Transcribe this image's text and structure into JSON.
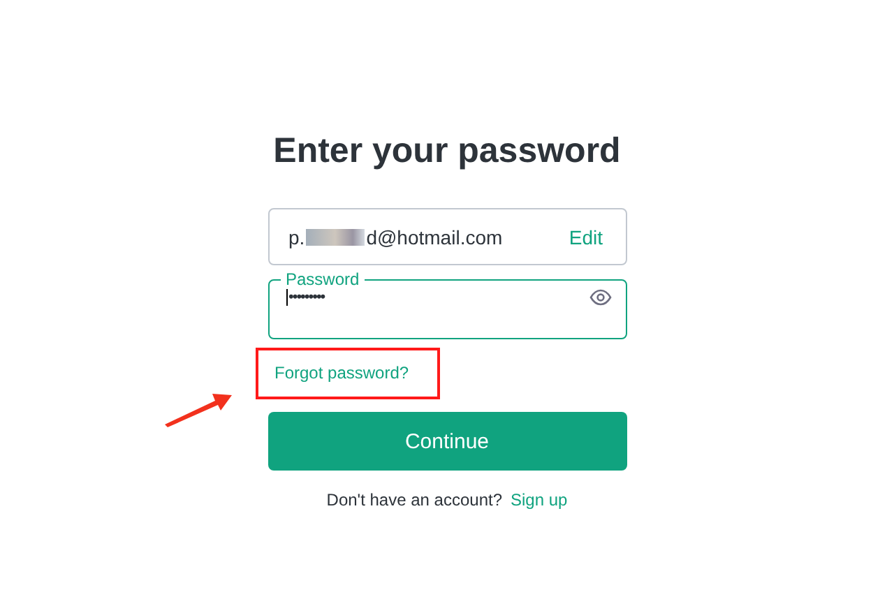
{
  "title": "Enter your password",
  "email": {
    "prefix": "p.",
    "suffix": "d@hotmail.com",
    "redacted": true,
    "edit": "Edit"
  },
  "password": {
    "label": "Password",
    "value": "•••••••••",
    "focused": true
  },
  "forgot_link": {
    "label": "Forgot password?",
    "highlighted": true
  },
  "continue_button": "Continue",
  "signup": {
    "prompt": "Don't have an account?",
    "link": "Sign up"
  }
}
